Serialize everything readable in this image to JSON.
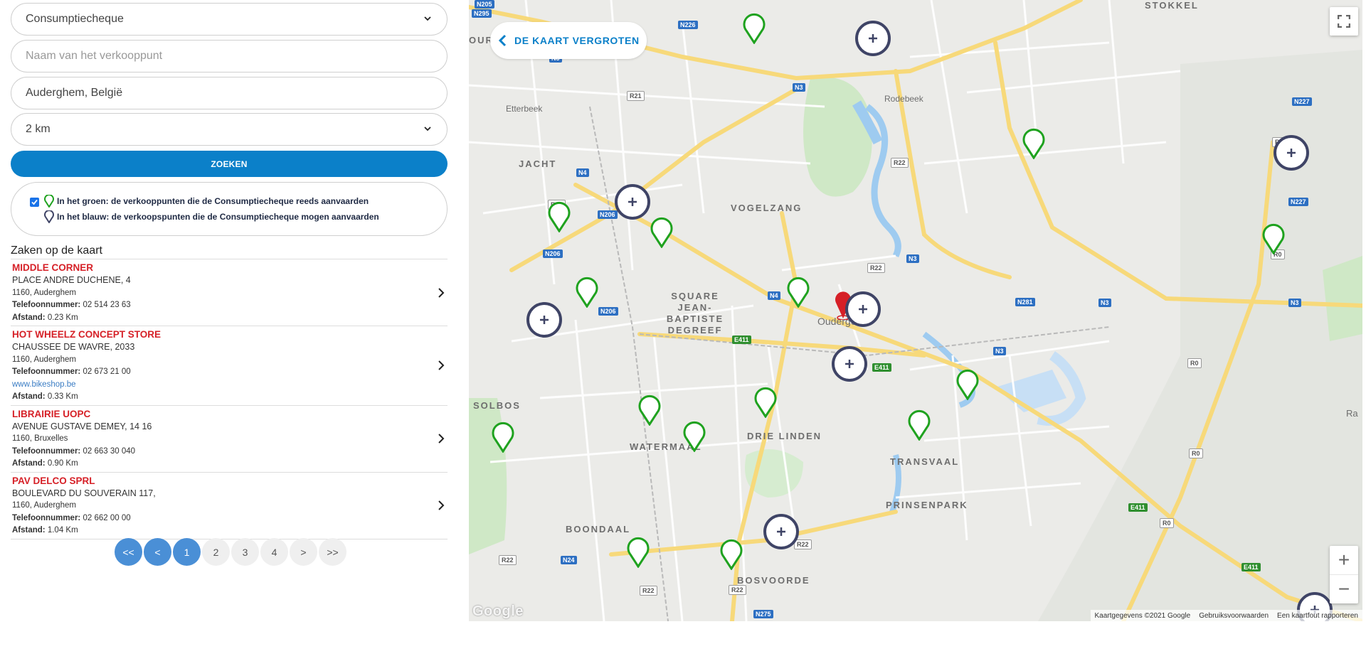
{
  "form": {
    "category_select": "Consumptiecheque",
    "name_placeholder": "Naam van het verkooppunt",
    "location_value": "Auderghem, België",
    "radius_select": "2 km",
    "search_label": "ZOEKEN"
  },
  "legend": {
    "checkbox_checked": true,
    "green_text": "In het groen: de verkooppunten die de Consumptiecheque reeds aanvaarden",
    "blue_text": "In het blauw: de verkoopspunten die de Consumptiecheque mogen aanvaarden"
  },
  "results": {
    "title": "Zaken op de kaart",
    "phone_label": "Telefoonnummer:",
    "distance_label": "Afstand:",
    "items": [
      {
        "name": "MIDDLE CORNER",
        "street": "PLACE ANDRE DUCHENE, 4",
        "city": "1160, Auderghem",
        "phone": "02 514 23 63",
        "website": "",
        "distance": "0.23 Km"
      },
      {
        "name": "HOT WHEELZ CONCEPT STORE",
        "street": "CHAUSSEE DE WAVRE, 2033",
        "city": "1160, Auderghem",
        "phone": "02 673 21 00",
        "website": "www.bikeshop.be",
        "distance": "0.33 Km"
      },
      {
        "name": "LIBRAIRIE UOPC",
        "street": "AVENUE GUSTAVE DEMEY, 14 16",
        "city": "1160, Bruxelles",
        "phone": "02 663 30 040",
        "website": "",
        "distance": "0.90 Km"
      },
      {
        "name": "PAV DELCO SPRL",
        "street": "BOULEVARD DU SOUVERAIN 117,",
        "city": "1160, Auderghem",
        "phone": "02 662 00 00",
        "website": "",
        "distance": "1.04 Km"
      }
    ]
  },
  "pagination": {
    "first": "<<",
    "prev": "<",
    "pages": [
      "1",
      "2",
      "3",
      "4"
    ],
    "current": "1",
    "next": ">",
    "last": ">>"
  },
  "map": {
    "enlarge_label": "DE KAART VERGROTEN",
    "zoom_in": "+",
    "zoom_out": "−",
    "attribution": [
      "Kaartgegevens ©2021 Google",
      "Gebruiksvoorwaarden",
      "Een kaartfout rapporteren"
    ],
    "logo": "Google",
    "districts": [
      "STOKKEL",
      "Etterbeek",
      "JACHT",
      "VOGELZANG",
      "SQUARE JEAN-BAPTISTE DEGREEF",
      "SOLBOS",
      "WATERMAAL",
      "DRIE LINDEN",
      "TRANSVAAL",
      "PRINSENPARK",
      "BOONDAAL",
      "BOSVOORDE",
      "Rodebeek",
      "Oudergem",
      "OUR",
      "Ra"
    ],
    "road_labels": [
      "N3",
      "N226",
      "R21",
      "N4",
      "N206",
      "E411",
      "R22",
      "N281",
      "R0",
      "N227",
      "N275",
      "N24",
      "N205",
      "N295"
    ],
    "colors": {
      "accepted": "#1fa21f",
      "may_accept": "#3f4466",
      "selected": "#d62027",
      "accent": "#0b80c9"
    }
  }
}
